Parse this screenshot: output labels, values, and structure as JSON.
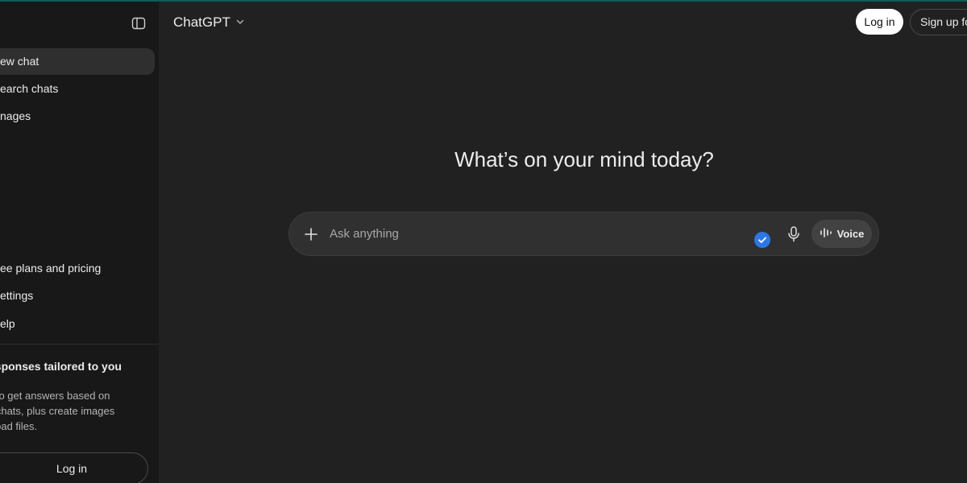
{
  "sidebar": {
    "items": [
      {
        "label": "ew chat"
      },
      {
        "label": "earch chats"
      },
      {
        "label": "nages"
      }
    ],
    "bottom_items": [
      {
        "label": "ee plans and pricing"
      },
      {
        "label": "ettings"
      },
      {
        "label": "elp"
      }
    ],
    "promo": {
      "title": "esponses tailored to you",
      "lines": [
        "n to get answers based on",
        "d chats, plus create images",
        "pload files."
      ]
    },
    "login_label": "Log in"
  },
  "header": {
    "model_name": "ChatGPT",
    "login_label": "Log in",
    "signup_label": "Sign up fo"
  },
  "main": {
    "headline": "What’s on your mind today?",
    "composer": {
      "placeholder": "Ask anything",
      "voice_label": "Voice"
    }
  },
  "colors": {
    "background": "#212121",
    "sidebar": "#181818",
    "composer": "#303030",
    "accent_blue": "#2c77e8"
  }
}
